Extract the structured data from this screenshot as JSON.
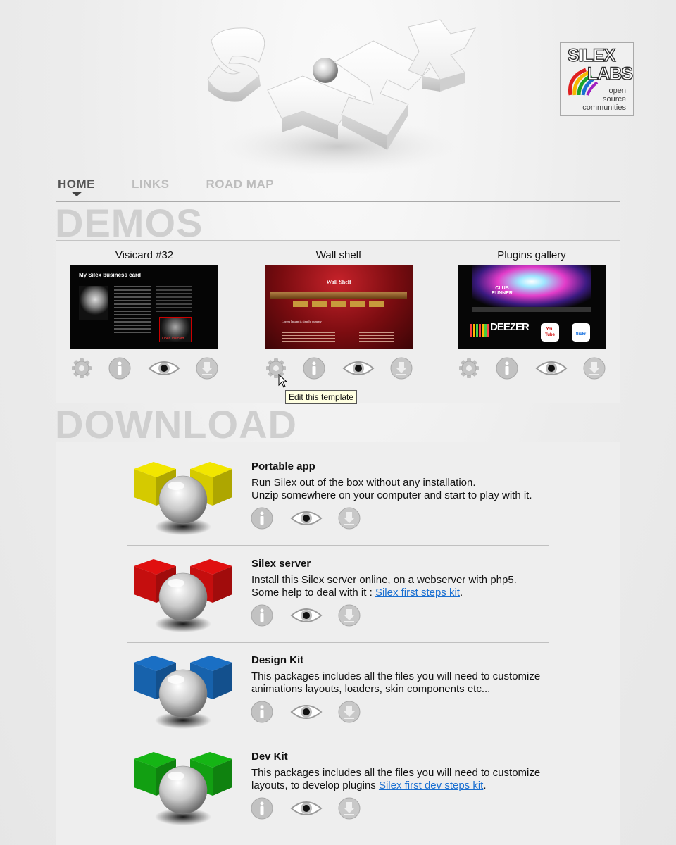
{
  "header": {
    "logo_icon": "silex-3d-logo",
    "labs": {
      "line1": "SILEX",
      "line2": "LABS",
      "sub1": "open",
      "sub2": "source",
      "sub3": "communities"
    }
  },
  "nav": {
    "items": [
      {
        "label": "HOME",
        "active": true
      },
      {
        "label": "LINKS",
        "active": false
      },
      {
        "label": "ROAD MAP",
        "active": false
      }
    ]
  },
  "demos": {
    "title": "DEMOS",
    "items": [
      {
        "title": "Visicard #32",
        "thumb_heading": "My Silex business card",
        "thumb_caption": "Open Visicard"
      },
      {
        "title": "Wall shelf",
        "thumb_heading": "Wall Shelf",
        "thumb_caption": "Lorem Ipsum is simply dummy"
      },
      {
        "title": "Plugins gallery",
        "thumb_heading": "CLUB RUNNER",
        "thumb_brand1": "DEEZER",
        "thumb_brand2": "You Tube",
        "thumb_brand3": "flickr"
      }
    ],
    "icons": [
      "gear-icon",
      "info-icon",
      "eye-icon",
      "download-icon"
    ],
    "tooltip": "Edit this template"
  },
  "download": {
    "title": "DOWNLOAD",
    "items": [
      {
        "title": "Portable app",
        "color": "#f2e600",
        "line1": "Run Silex out of the box without any installation.",
        "line2": "Unzip somewhere on your computer and start to play with it.",
        "link": ""
      },
      {
        "title": "Silex server",
        "color": "#e01010",
        "line1": "Install  this Silex server online, on a webserver with php5.",
        "line2": "Some help to deal with it : ",
        "link": "Silex first steps kit",
        "after": "."
      },
      {
        "title": "Design Kit",
        "color": "#1a6fc4",
        "line1": "This packages includes all the files you will need to customize",
        "line2": "animations layouts, loaders, skin components etc...",
        "link": ""
      },
      {
        "title": "Dev Kit",
        "color": "#15b515",
        "line1": "This packages includes all the files you will need to customize",
        "line2": "layouts, to develop plugins ",
        "link": "Silex first dev steps kit",
        "after": "."
      }
    ]
  }
}
